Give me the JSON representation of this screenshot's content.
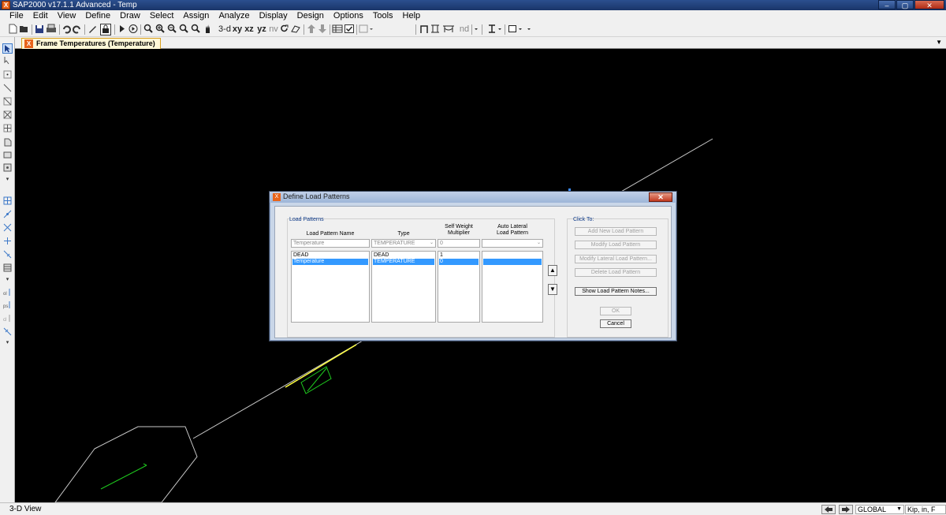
{
  "app": {
    "title": "SAP2000 v17.1.1 Advanced - Temp",
    "icon_glyph": "X"
  },
  "window_buttons": {
    "minimize": "–",
    "restore": "▢",
    "close": "✕"
  },
  "menu": [
    "File",
    "Edit",
    "View",
    "Define",
    "Draw",
    "Select",
    "Assign",
    "Analyze",
    "Display",
    "Design",
    "Options",
    "Tools",
    "Help"
  ],
  "toolbar": {
    "view_3d": "3-d",
    "view_xy": "xy",
    "view_xz": "xz",
    "view_yz": "yz",
    "view_nv": "nv",
    "nd_label": "nd",
    "icons": [
      "new-file-icon",
      "open-file-icon",
      "save-icon",
      "print-icon",
      "undo-icon",
      "redo-icon",
      "pencil-icon",
      "lock-icon",
      "run-icon",
      "run-step-icon",
      "zoom-window-icon",
      "zoom-in-icon",
      "zoom-out-icon",
      "zoom-previous-icon",
      "zoom-restore-icon",
      "pan-icon",
      "rotate-icon",
      "perspective-icon",
      "move-up-icon",
      "move-down-icon",
      "table-icon",
      "check-icon",
      "grid-options-icon",
      "frame-icon",
      "section-icon",
      "cursor-icon",
      "square-icon"
    ]
  },
  "tab": {
    "label": "Frame Temperatures (Temperature)"
  },
  "sidebar_icons": [
    "select-pointer-icon",
    "reshape-icon",
    "draw-point-icon",
    "draw-frame-icon",
    "quick-draw-frame-icon",
    "draw-brace-icon",
    "draw-secondary-icon",
    "draw-area-icon",
    "draw-rect-area-icon",
    "quick-draw-area-icon",
    "draw-link-icon",
    "draw-solid-icon",
    "snap-point-icon",
    "snap-line-icon",
    "snap-intersection-icon",
    "snap-perpendicular-icon",
    "snap-grid-icon",
    "snap-end-icon",
    "snap-ps-icon",
    "snap-other-icon",
    "section-cut-icon"
  ],
  "statusbar": {
    "view_label": "3-D View",
    "coord_system": "GLOBAL",
    "units": "Kip, in, F"
  },
  "dialog": {
    "title": "Define Load Patterns",
    "close_glyph": "✕",
    "group_label": "Load Patterns",
    "columns": {
      "name": "Load Pattern Name",
      "type": "Type",
      "self_weight": "Self Weight\nMultiplier",
      "auto_lateral": "Auto Lateral\nLoad Pattern"
    },
    "edit_row": {
      "name": "Temperature",
      "type": "TEMPERATURE",
      "multiplier": "0",
      "auto_lateral": ""
    },
    "rows": [
      {
        "name": "DEAD",
        "type": "DEAD",
        "multiplier": "1",
        "auto_lateral": "",
        "selected": false
      },
      {
        "name": "Temperature",
        "type": "TEMPERATURE",
        "multiplier": "0",
        "auto_lateral": "",
        "selected": true
      }
    ],
    "click_to_label": "Click To:",
    "buttons": {
      "add": "Add New Load Pattern",
      "modify": "Modify Load Pattern",
      "modify_lateral": "Modify Lateral Load Pattern...",
      "delete": "Delete Load Pattern",
      "show_notes": "Show Load Pattern Notes...",
      "ok": "OK",
      "cancel": "Cancel"
    },
    "move_up_glyph": "▲",
    "move_down_glyph": "▼"
  },
  "colors": {
    "canvas_bg": "#000000",
    "model_line": "#c8c8c8",
    "selected_frame": "#ffff40",
    "temperature_load": "#1ec81e",
    "selection": "#3399ff"
  }
}
